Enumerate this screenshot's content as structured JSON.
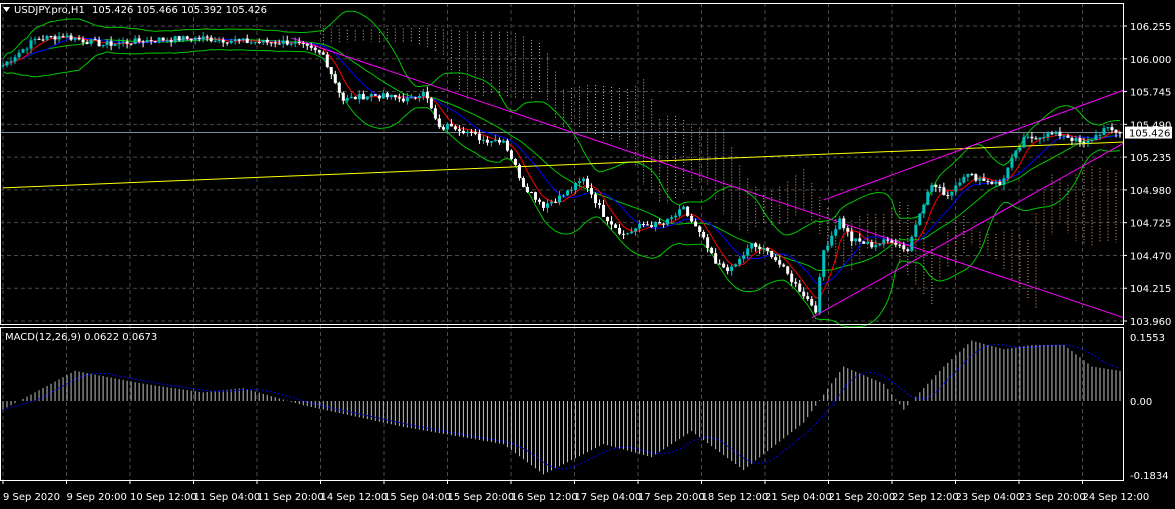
{
  "header": {
    "title": "USDJPY.pro,H1",
    "ohlc": "105.426 105.466 105.392 105.426"
  },
  "macd_label": "MACD(12,26,9) 0.0622 0.0673",
  "colors": {
    "bg": "#000000",
    "grid": "#4a4a4a",
    "bull": "#00c0c0",
    "bear": "#ffffff",
    "ma_fast": "#ff0000",
    "ma_slow": "#0000ff",
    "bands": "#00c800",
    "cloud": "#f4a460",
    "trend": "#ff00ff",
    "yellow": "#ffff00",
    "macd_signal": "#0000ff",
    "hist": "#c0c0c0"
  },
  "chart_data": {
    "type": "candlestick",
    "symbol": "USDJPY.pro",
    "timeframe": "H1",
    "bars": 280,
    "ylim": [
      103.96,
      106.255
    ],
    "yticks": [
      "106.255",
      "106.000",
      "105.745",
      "105.490",
      "105.235",
      "104.980",
      "104.725",
      "104.470",
      "104.215",
      "103.960"
    ],
    "current_price": "105.426",
    "xticks": [
      "9 Sep 2020",
      "9 Sep 20:00",
      "10 Sep 12:00",
      "11 Sep 04:00",
      "11 Sep 20:00",
      "14 Sep 12:00",
      "15 Sep 04:00",
      "15 Sep 20:00",
      "16 Sep 12:00",
      "17 Sep 04:00",
      "17 Sep 20:00",
      "18 Sep 12:00",
      "21 Sep 04:00",
      "21 Sep 20:00",
      "22 Sep 12:00",
      "23 Sep 04:00",
      "23 Sep 20:00",
      "24 Sep 12:00"
    ],
    "close_keypoints": [
      [
        0,
        105.95
      ],
      [
        8,
        106.15
      ],
      [
        15,
        106.18
      ],
      [
        25,
        106.11
      ],
      [
        38,
        106.15
      ],
      [
        50,
        106.16
      ],
      [
        62,
        106.13
      ],
      [
        72,
        106.13
      ],
      [
        80,
        106.03
      ],
      [
        85,
        105.68
      ],
      [
        92,
        105.72
      ],
      [
        102,
        105.68
      ],
      [
        105,
        105.76
      ],
      [
        109,
        105.45
      ],
      [
        112,
        105.49
      ],
      [
        120,
        105.37
      ],
      [
        125,
        105.37
      ],
      [
        130,
        105.02
      ],
      [
        135,
        104.86
      ],
      [
        140,
        104.94
      ],
      [
        145,
        105.06
      ],
      [
        150,
        104.79
      ],
      [
        155,
        104.63
      ],
      [
        160,
        104.71
      ],
      [
        165,
        104.71
      ],
      [
        170,
        104.83
      ],
      [
        175,
        104.59
      ],
      [
        178,
        104.4
      ],
      [
        182,
        104.36
      ],
      [
        187,
        104.55
      ],
      [
        192,
        104.48
      ],
      [
        197,
        104.28
      ],
      [
        201,
        104.13
      ],
      [
        203,
        104.05
      ],
      [
        205,
        104.51
      ],
      [
        209,
        104.75
      ],
      [
        212,
        104.59
      ],
      [
        217,
        104.55
      ],
      [
        222,
        104.59
      ],
      [
        226,
        104.51
      ],
      [
        229,
        104.82
      ],
      [
        232,
        105.02
      ],
      [
        236,
        104.94
      ],
      [
        240,
        105.1
      ],
      [
        245,
        105.06
      ],
      [
        249,
        105.02
      ],
      [
        252,
        105.21
      ],
      [
        255,
        105.37
      ],
      [
        260,
        105.41
      ],
      [
        265,
        105.41
      ],
      [
        270,
        105.33
      ],
      [
        275,
        105.45
      ],
      [
        279,
        105.43
      ]
    ],
    "macd_ylim": [
      -0.1834,
      0.1553
    ],
    "macd_yticks": [
      "0.1553",
      "0.00",
      "-0.1834"
    ],
    "macd_keypoints": [
      [
        0,
        -0.02
      ],
      [
        10,
        0.03
      ],
      [
        18,
        0.07
      ],
      [
        35,
        0.04
      ],
      [
        50,
        0.02
      ],
      [
        60,
        0.03
      ],
      [
        75,
        -0.01
      ],
      [
        100,
        -0.06
      ],
      [
        125,
        -0.1
      ],
      [
        135,
        -0.17
      ],
      [
        150,
        -0.1
      ],
      [
        162,
        -0.13
      ],
      [
        172,
        -0.07
      ],
      [
        185,
        -0.16
      ],
      [
        200,
        -0.05
      ],
      [
        210,
        0.08
      ],
      [
        220,
        0.04
      ],
      [
        225,
        -0.02
      ],
      [
        235,
        0.08
      ],
      [
        242,
        0.14
      ],
      [
        250,
        0.12
      ],
      [
        257,
        0.13
      ],
      [
        265,
        0.13
      ],
      [
        272,
        0.08
      ],
      [
        279,
        0.07
      ]
    ],
    "lines": {
      "yellow": [
        [
          0,
          104.996
        ],
        [
          280,
          105.353
        ]
      ],
      "trend_down": [
        [
          72,
          106.162
        ],
        [
          280,
          103.985
        ]
      ],
      "channel_low": [
        [
          202,
          103.985
        ],
        [
          280,
          105.345
        ]
      ],
      "channel_high": [
        [
          205,
          104.902
        ],
        [
          280,
          105.757
        ]
      ]
    }
  }
}
